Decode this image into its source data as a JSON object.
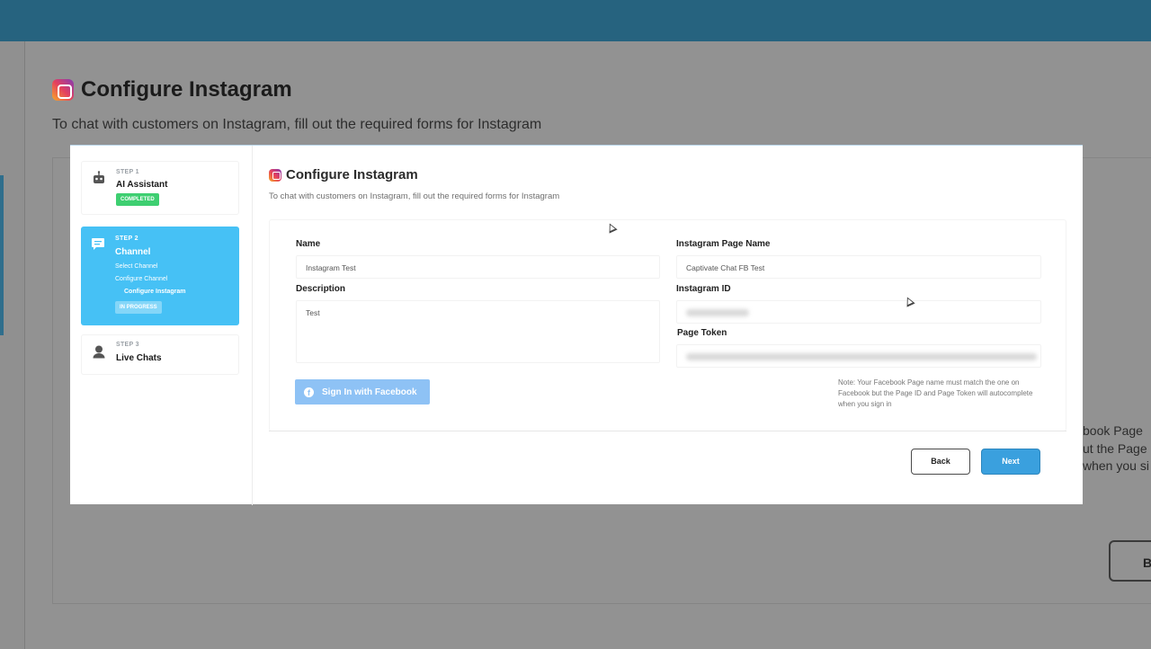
{
  "background": {
    "title": "Configure Instagram",
    "subtitle": "To chat with customers on Instagram, fill out the required forms for Instagram",
    "note_fragment": "book Page\nut the Page\nwhen you si",
    "back_fragment": "B"
  },
  "steps": [
    {
      "label": "STEP 1",
      "title": "AI Assistant",
      "badge": "COMPLETED"
    },
    {
      "label": "STEP 2",
      "title": "Channel",
      "sub_items": [
        "Select Channel",
        "Configure Channel",
        "Configure Instagram"
      ],
      "badge": "IN PROGRESS"
    },
    {
      "label": "STEP 3",
      "title": "Live Chats"
    }
  ],
  "modal": {
    "title": "Configure Instagram",
    "subtitle": "To chat with customers on Instagram, fill out the required forms for Instagram",
    "fields": {
      "name_label": "Name",
      "name_value": "Instagram Test",
      "page_name_label": "Instagram Page Name",
      "page_name_value": "Captivate Chat FB Test",
      "description_label": "Description",
      "description_value": "Test",
      "instagram_id_label": "Instagram ID",
      "page_token_label": "Page Token"
    },
    "facebook_button": "Sign In with Facebook",
    "note": "Note: Your Facebook Page name must match the one on Facebook but the Page ID and Page Token will autocomplete when you sign in",
    "back_button": "Back",
    "next_button": "Next"
  },
  "colors": {
    "topbar": "#26637f",
    "active_step": "#46c1f5",
    "completed": "#3ecf71",
    "primary": "#3aa0de",
    "facebook": "#8ec2f5"
  }
}
